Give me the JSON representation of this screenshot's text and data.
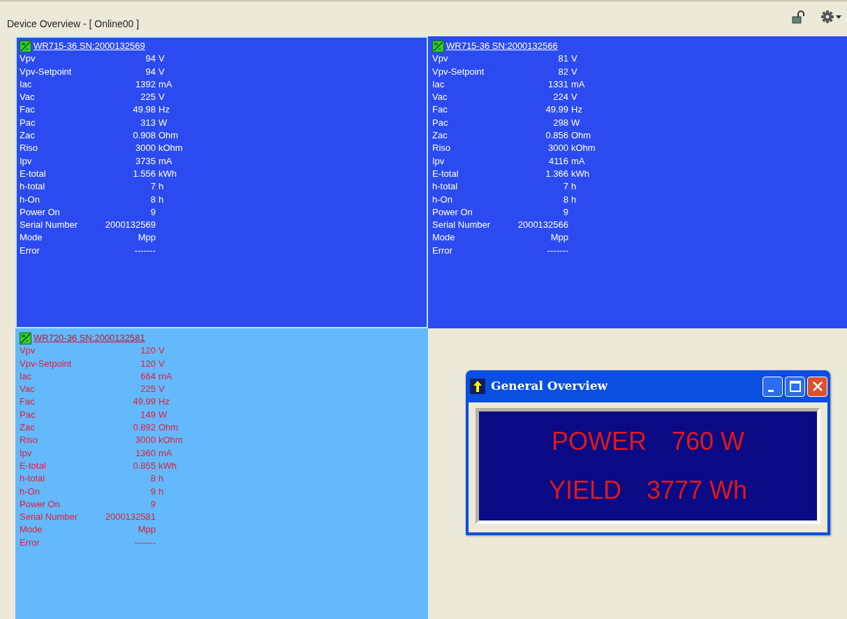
{
  "header": {
    "title": "Device Overview - [ Online00 ]"
  },
  "devices": [
    {
      "title": "WR715-36 SN:2000132569",
      "selected": true,
      "kind": "normal",
      "rows": [
        {
          "label": "Vpv",
          "value": "94",
          "unit": "V"
        },
        {
          "label": "Vpv-Setpoint",
          "value": "94",
          "unit": "V"
        },
        {
          "label": "Iac",
          "value": "1392",
          "unit": "mA"
        },
        {
          "label": "Vac",
          "value": "225",
          "unit": "V"
        },
        {
          "label": "Fac",
          "value": "49.98",
          "unit": "Hz"
        },
        {
          "label": "Pac",
          "value": "313",
          "unit": "W"
        },
        {
          "label": "Zac",
          "value": "0.908",
          "unit": "Ohm"
        },
        {
          "label": "Riso",
          "value": "3000",
          "unit": "kOhm"
        },
        {
          "label": "Ipv",
          "value": "3735",
          "unit": "mA"
        },
        {
          "label": "E-total",
          "value": "1.556",
          "unit": "kWh"
        },
        {
          "label": "h-total",
          "value": "7",
          "unit": "h"
        },
        {
          "label": "h-On",
          "value": "8",
          "unit": "h"
        },
        {
          "label": "Power On",
          "value": "9"
        },
        {
          "label": "Serial Number",
          "value": "2000132569"
        },
        {
          "label": "Mode",
          "value": "Mpp"
        },
        {
          "label": "Error",
          "value": "-------"
        }
      ]
    },
    {
      "title": "WR715-36 SN:2000132566",
      "selected": false,
      "kind": "normal",
      "rows": [
        {
          "label": "Vpv",
          "value": "81",
          "unit": "V"
        },
        {
          "label": "Vpv-Setpoint",
          "value": "82",
          "unit": "V"
        },
        {
          "label": "Iac",
          "value": "1331",
          "unit": "mA"
        },
        {
          "label": "Vac",
          "value": "224",
          "unit": "V"
        },
        {
          "label": "Fac",
          "value": "49.99",
          "unit": "Hz"
        },
        {
          "label": "Pac",
          "value": "298",
          "unit": "W"
        },
        {
          "label": "Zac",
          "value": "0.856",
          "unit": "Ohm"
        },
        {
          "label": "Riso",
          "value": "3000",
          "unit": "kOhm"
        },
        {
          "label": "Ipv",
          "value": "4116",
          "unit": "mA"
        },
        {
          "label": "E-total",
          "value": "1.366",
          "unit": "kWh"
        },
        {
          "label": "h-total",
          "value": "7",
          "unit": "h"
        },
        {
          "label": "h-On",
          "value": "8",
          "unit": "h"
        },
        {
          "label": "Power On",
          "value": "9"
        },
        {
          "label": "Serial Number",
          "value": "2000132566"
        },
        {
          "label": "Mode",
          "value": "Mpp"
        },
        {
          "label": "Error",
          "value": "-------"
        }
      ]
    },
    {
      "title": "WR720-36 SN:2000132581",
      "selected": false,
      "kind": "alert",
      "rows": [
        {
          "label": "Vpv",
          "value": "120",
          "unit": "V"
        },
        {
          "label": "Vpv-Setpoint",
          "value": "120",
          "unit": "V"
        },
        {
          "label": "Iac",
          "value": "664",
          "unit": "mA"
        },
        {
          "label": "Vac",
          "value": "225",
          "unit": "V"
        },
        {
          "label": "Fac",
          "value": "49.99",
          "unit": "Hz"
        },
        {
          "label": "Pac",
          "value": "149",
          "unit": "W"
        },
        {
          "label": "Zac",
          "value": "0.892",
          "unit": "Ohm"
        },
        {
          "label": "Riso",
          "value": "3000",
          "unit": "kOhm"
        },
        {
          "label": "Ipv",
          "value": "1360",
          "unit": "mA"
        },
        {
          "label": "E-total",
          "value": "0.855",
          "unit": "kWh"
        },
        {
          "label": "h-total",
          "value": "8",
          "unit": "h"
        },
        {
          "label": "h-On",
          "value": "9",
          "unit": "h"
        },
        {
          "label": "Power On",
          "value": "9"
        },
        {
          "label": "Serial Number",
          "value": "2000132581"
        },
        {
          "label": "Mode",
          "value": "Mpp"
        },
        {
          "label": "Error",
          "value": "-------"
        }
      ]
    }
  ],
  "general_overview": {
    "title": "General Overview",
    "lines": [
      {
        "label": "POWER",
        "value": "760",
        "unit": "W"
      },
      {
        "label": "YIELD",
        "value": "3777",
        "unit": "Wh"
      }
    ]
  }
}
